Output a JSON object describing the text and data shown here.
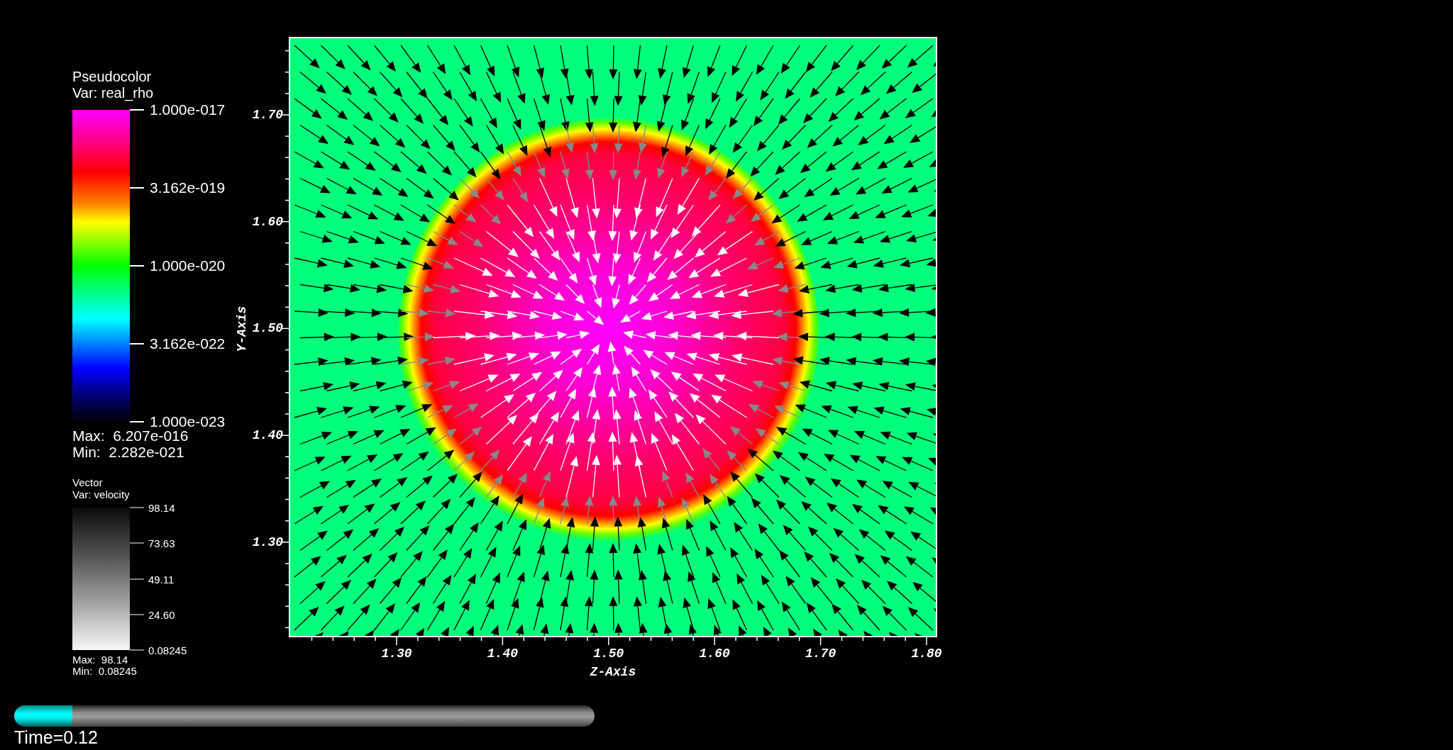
{
  "pseudocolor_legend": {
    "title": "Pseudocolor",
    "variable": "Var: real_rho",
    "ticks": [
      "1.000e-017",
      "3.162e-019",
      "1.000e-020",
      "3.162e-022",
      "1.000e-023"
    ],
    "max": "Max:  6.207e-016",
    "min": "Min:  2.282e-021"
  },
  "vector_legend": {
    "title": "Vector",
    "variable": "Var: velocity",
    "ticks": [
      "98.14",
      "73.63",
      "49.11",
      "24.60",
      "0.08245"
    ],
    "max": "Max:  98.14",
    "min": "Min:  0.08245"
  },
  "plot": {
    "y_axis": {
      "title": "Y-Axis",
      "ticks": [
        "1.70",
        "1.60",
        "1.50",
        "1.40",
        "1.30"
      ]
    },
    "x_axis": {
      "title": "Z-Axis",
      "ticks": [
        "1.30",
        "1.40",
        "1.50",
        "1.60",
        "1.70",
        "1.80"
      ]
    }
  },
  "time_slider": {
    "level": 0.1,
    "label": "Time=0.12"
  }
}
